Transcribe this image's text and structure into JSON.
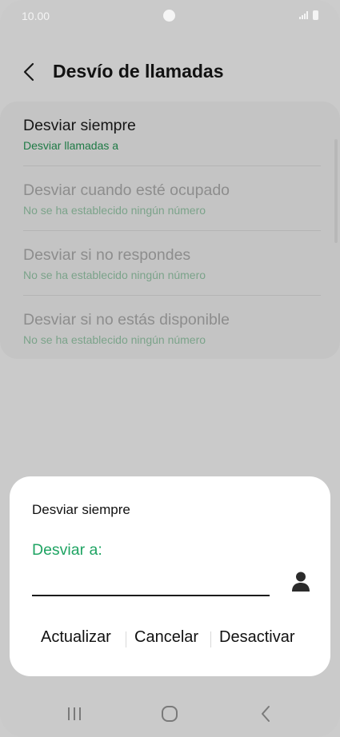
{
  "status_bar": {
    "time": "10.00"
  },
  "header": {
    "title": "Desvío de llamadas"
  },
  "list": {
    "items": [
      {
        "title": "Desviar siempre",
        "subtitle": "Desviar llamadas a"
      },
      {
        "title": "Desviar cuando esté ocupado",
        "subtitle": "No se ha establecido ningún número"
      },
      {
        "title": "Desviar si no respondes",
        "subtitle": "No se ha establecido ningún número"
      },
      {
        "title": "Desviar si no estás disponible",
        "subtitle": "No se ha establecido ningún número"
      }
    ]
  },
  "dialog": {
    "title": "Desviar siempre",
    "field_label": "Desviar a:",
    "field_value": "",
    "buttons": {
      "update": "Actualizar",
      "cancel": "Cancelar",
      "deactivate": "Desactivar"
    }
  },
  "colors": {
    "accent": "#1fa463",
    "subtitle_active": "#1e7a45"
  }
}
